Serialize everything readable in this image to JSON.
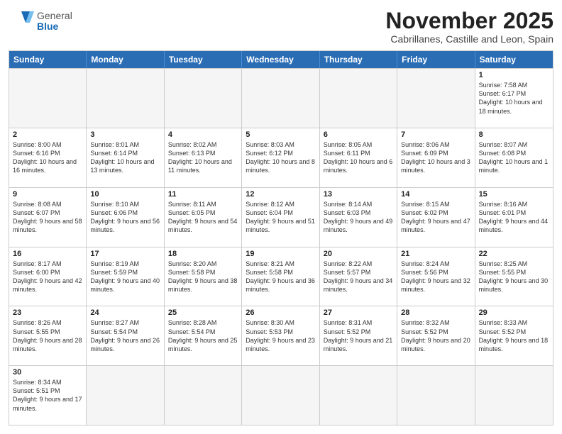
{
  "logo": {
    "text_general": "General",
    "text_blue": "Blue"
  },
  "title": "November 2025",
  "subtitle": "Cabrillanes, Castille and Leon, Spain",
  "header_days": [
    "Sunday",
    "Monday",
    "Tuesday",
    "Wednesday",
    "Thursday",
    "Friday",
    "Saturday"
  ],
  "weeks": [
    [
      {
        "day": "",
        "info": ""
      },
      {
        "day": "",
        "info": ""
      },
      {
        "day": "",
        "info": ""
      },
      {
        "day": "",
        "info": ""
      },
      {
        "day": "",
        "info": ""
      },
      {
        "day": "",
        "info": ""
      },
      {
        "day": "1",
        "info": "Sunrise: 7:58 AM\nSunset: 6:17 PM\nDaylight: 10 hours and 18 minutes."
      }
    ],
    [
      {
        "day": "2",
        "info": "Sunrise: 8:00 AM\nSunset: 6:16 PM\nDaylight: 10 hours and 16 minutes."
      },
      {
        "day": "3",
        "info": "Sunrise: 8:01 AM\nSunset: 6:14 PM\nDaylight: 10 hours and 13 minutes."
      },
      {
        "day": "4",
        "info": "Sunrise: 8:02 AM\nSunset: 6:13 PM\nDaylight: 10 hours and 11 minutes."
      },
      {
        "day": "5",
        "info": "Sunrise: 8:03 AM\nSunset: 6:12 PM\nDaylight: 10 hours and 8 minutes."
      },
      {
        "day": "6",
        "info": "Sunrise: 8:05 AM\nSunset: 6:11 PM\nDaylight: 10 hours and 6 minutes."
      },
      {
        "day": "7",
        "info": "Sunrise: 8:06 AM\nSunset: 6:09 PM\nDaylight: 10 hours and 3 minutes."
      },
      {
        "day": "8",
        "info": "Sunrise: 8:07 AM\nSunset: 6:08 PM\nDaylight: 10 hours and 1 minute."
      }
    ],
    [
      {
        "day": "9",
        "info": "Sunrise: 8:08 AM\nSunset: 6:07 PM\nDaylight: 9 hours and 58 minutes."
      },
      {
        "day": "10",
        "info": "Sunrise: 8:10 AM\nSunset: 6:06 PM\nDaylight: 9 hours and 56 minutes."
      },
      {
        "day": "11",
        "info": "Sunrise: 8:11 AM\nSunset: 6:05 PM\nDaylight: 9 hours and 54 minutes."
      },
      {
        "day": "12",
        "info": "Sunrise: 8:12 AM\nSunset: 6:04 PM\nDaylight: 9 hours and 51 minutes."
      },
      {
        "day": "13",
        "info": "Sunrise: 8:14 AM\nSunset: 6:03 PM\nDaylight: 9 hours and 49 minutes."
      },
      {
        "day": "14",
        "info": "Sunrise: 8:15 AM\nSunset: 6:02 PM\nDaylight: 9 hours and 47 minutes."
      },
      {
        "day": "15",
        "info": "Sunrise: 8:16 AM\nSunset: 6:01 PM\nDaylight: 9 hours and 44 minutes."
      }
    ],
    [
      {
        "day": "16",
        "info": "Sunrise: 8:17 AM\nSunset: 6:00 PM\nDaylight: 9 hours and 42 minutes."
      },
      {
        "day": "17",
        "info": "Sunrise: 8:19 AM\nSunset: 5:59 PM\nDaylight: 9 hours and 40 minutes."
      },
      {
        "day": "18",
        "info": "Sunrise: 8:20 AM\nSunset: 5:58 PM\nDaylight: 9 hours and 38 minutes."
      },
      {
        "day": "19",
        "info": "Sunrise: 8:21 AM\nSunset: 5:58 PM\nDaylight: 9 hours and 36 minutes."
      },
      {
        "day": "20",
        "info": "Sunrise: 8:22 AM\nSunset: 5:57 PM\nDaylight: 9 hours and 34 minutes."
      },
      {
        "day": "21",
        "info": "Sunrise: 8:24 AM\nSunset: 5:56 PM\nDaylight: 9 hours and 32 minutes."
      },
      {
        "day": "22",
        "info": "Sunrise: 8:25 AM\nSunset: 5:55 PM\nDaylight: 9 hours and 30 minutes."
      }
    ],
    [
      {
        "day": "23",
        "info": "Sunrise: 8:26 AM\nSunset: 5:55 PM\nDaylight: 9 hours and 28 minutes."
      },
      {
        "day": "24",
        "info": "Sunrise: 8:27 AM\nSunset: 5:54 PM\nDaylight: 9 hours and 26 minutes."
      },
      {
        "day": "25",
        "info": "Sunrise: 8:28 AM\nSunset: 5:54 PM\nDaylight: 9 hours and 25 minutes."
      },
      {
        "day": "26",
        "info": "Sunrise: 8:30 AM\nSunset: 5:53 PM\nDaylight: 9 hours and 23 minutes."
      },
      {
        "day": "27",
        "info": "Sunrise: 8:31 AM\nSunset: 5:52 PM\nDaylight: 9 hours and 21 minutes."
      },
      {
        "day": "28",
        "info": "Sunrise: 8:32 AM\nSunset: 5:52 PM\nDaylight: 9 hours and 20 minutes."
      },
      {
        "day": "29",
        "info": "Sunrise: 8:33 AM\nSunset: 5:52 PM\nDaylight: 9 hours and 18 minutes."
      }
    ],
    [
      {
        "day": "30",
        "info": "Sunrise: 8:34 AM\nSunset: 5:51 PM\nDaylight: 9 hours and 17 minutes."
      },
      {
        "day": "",
        "info": ""
      },
      {
        "day": "",
        "info": ""
      },
      {
        "day": "",
        "info": ""
      },
      {
        "day": "",
        "info": ""
      },
      {
        "day": "",
        "info": ""
      },
      {
        "day": "",
        "info": ""
      }
    ]
  ]
}
